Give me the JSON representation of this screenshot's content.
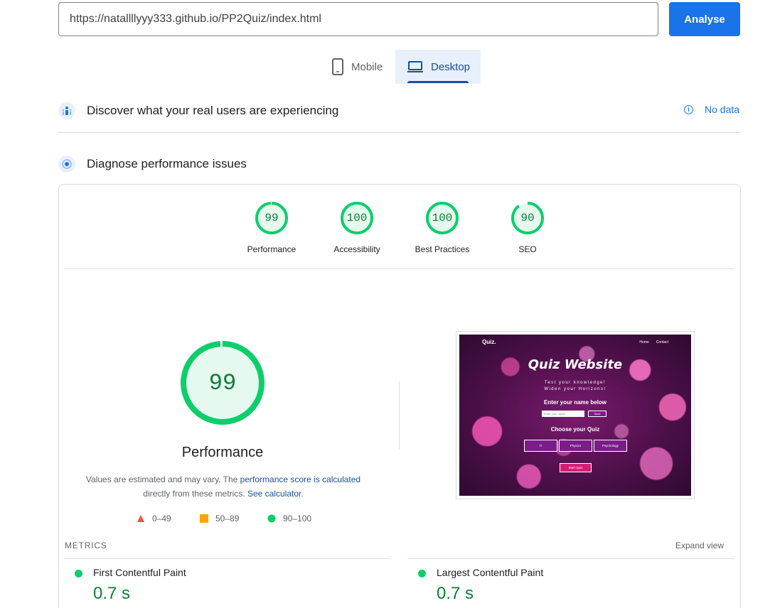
{
  "search": {
    "url_value": "https://natallllyyy333.github.io/PP2Quiz/index.html",
    "analyse_label": "Analyse"
  },
  "tabs": [
    {
      "label": "Mobile",
      "icon": "phone-icon",
      "selected": false
    },
    {
      "label": "Desktop",
      "icon": "laptop-icon",
      "selected": true
    }
  ],
  "field_data": {
    "title": "Discover what your real users are experiencing",
    "status": "No data"
  },
  "lab_data": {
    "title": "Diagnose performance issues"
  },
  "scores": [
    {
      "label": "Performance",
      "value": "99",
      "fraction": 0.99
    },
    {
      "label": "Accessibility",
      "value": "100",
      "fraction": 1.0
    },
    {
      "label": "Best Practices",
      "value": "100",
      "fraction": 1.0
    },
    {
      "label": "SEO",
      "value": "90",
      "fraction": 0.9
    }
  ],
  "performance": {
    "score": "99",
    "fraction": 0.99,
    "title": "Performance",
    "note_prefix": "Values are estimated and may vary. The ",
    "note_link1": "performance score is calculated",
    "note_middle": "directly from these metrics. ",
    "note_link2": "See calculator",
    "note_suffix": "."
  },
  "legend": [
    {
      "range": "0–49",
      "shape": "triangle",
      "color": "#ff4e42"
    },
    {
      "range": "50–89",
      "shape": "square",
      "color": "#ffa400"
    },
    {
      "range": "90–100",
      "shape": "circle",
      "color": "#0cce6b"
    }
  ],
  "screenshot": {
    "logo": "Quiz.",
    "nav": [
      "Home",
      "Contact"
    ],
    "title": "Quiz Website",
    "subtitle_line1": "Test your knowledge!",
    "subtitle_line2": "Widen your Horizons!",
    "name_heading": "Enter your name below",
    "name_placeholder": "Enter your name",
    "save_label": "Save",
    "choose_heading": "Choose your Quiz",
    "quizzes": [
      "IT",
      "Physics",
      "Psychology"
    ],
    "start_label": "Start Quiz"
  },
  "metrics": {
    "label": "METRICS",
    "expand_label": "Expand view",
    "items": [
      {
        "name": "First Contentful Paint",
        "value": "0.7 s",
        "color": "#0cce6b"
      },
      {
        "name": "Largest Contentful Paint",
        "value": "0.7 s",
        "color": "#0cce6b"
      }
    ]
  },
  "colors": {
    "accent": "#1a73e8",
    "pass_green": "#0cce6b",
    "pass_text": "#0c7e36",
    "pass_fill": "#e6f9ee"
  }
}
